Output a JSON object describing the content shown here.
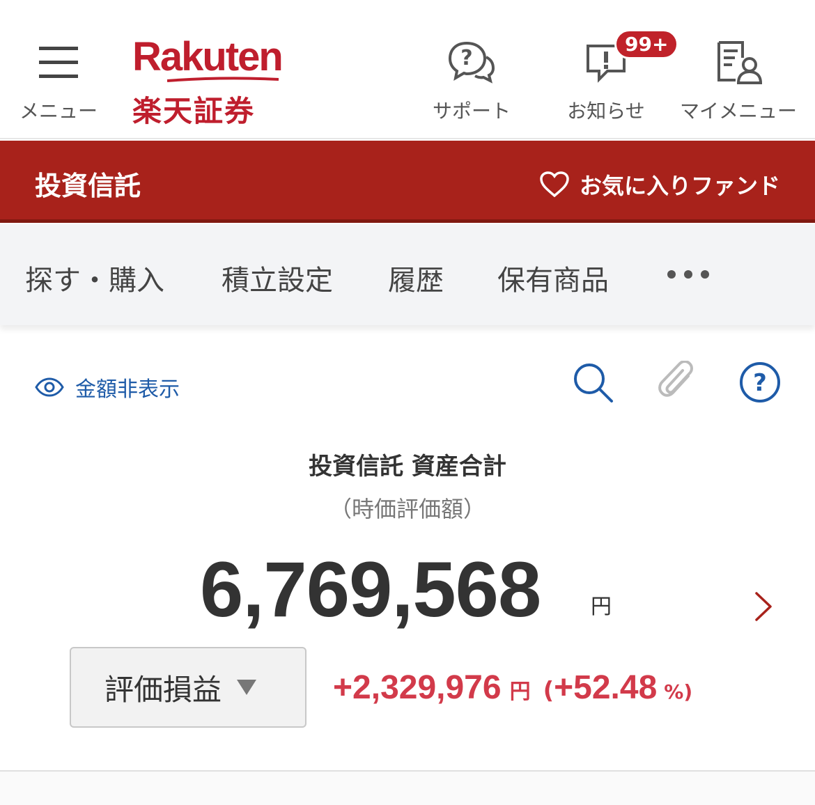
{
  "header": {
    "menu_label": "メニュー",
    "logo_en": "Rakuten",
    "logo_jp": "楽天証券",
    "support_label": "サポート",
    "notice_label": "お知らせ",
    "notice_badge": "99+",
    "mymenu_label": "マイメニュー"
  },
  "section_bar": {
    "title": "投資信託",
    "favorite_label": "お気に入りファンド"
  },
  "tabs": [
    {
      "label": "探す・購入"
    },
    {
      "label": "積立設定"
    },
    {
      "label": "履歴"
    },
    {
      "label": "保有商品"
    }
  ],
  "toolbar": {
    "hide_amount_label": "金額非表示",
    "icons": [
      "search-icon",
      "clip-icon",
      "help-icon"
    ]
  },
  "summary": {
    "title": "投資信託 資産合計",
    "subtitle": "（時価評価額）",
    "total_value": "6,769,568",
    "total_unit": "円",
    "select_label": "評価損益",
    "pl_value": "+2,329,976",
    "pl_unit": "円",
    "pl_paren_open": "(",
    "pl_percent": "+52.48",
    "pl_percent_unit": "%)"
  },
  "colors": {
    "brand_red": "#bf1e2d",
    "bar_red": "#a8221b",
    "link_blue": "#1e5ba8",
    "gain_red": "#d23a4a"
  }
}
